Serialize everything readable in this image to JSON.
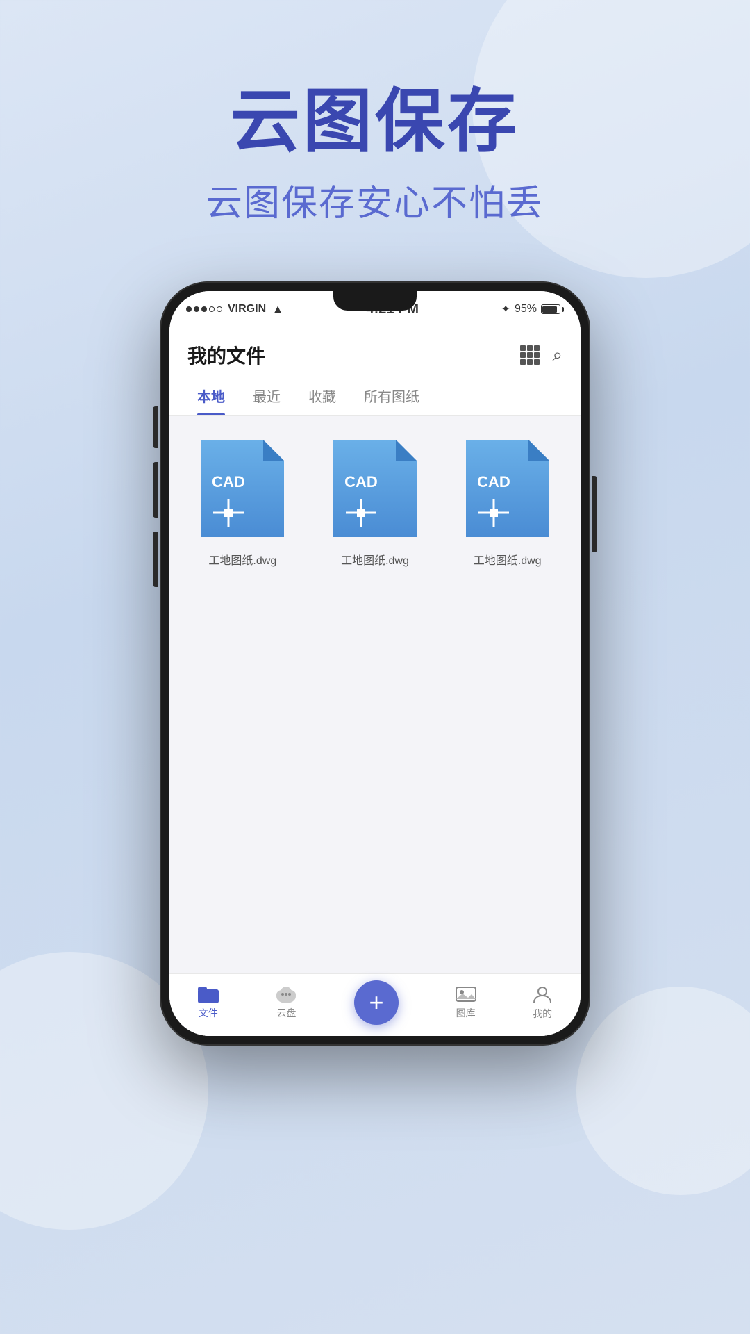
{
  "hero": {
    "title": "云图保存",
    "subtitle": "云图保存安心不怕丢"
  },
  "status_bar": {
    "carrier": "VIRGIN",
    "time": "4:21 PM",
    "battery": "95%"
  },
  "app": {
    "title": "我的文件",
    "tabs": [
      {
        "label": "本地",
        "active": true
      },
      {
        "label": "最近",
        "active": false
      },
      {
        "label": "收藏",
        "active": false
      },
      {
        "label": "所有图纸",
        "active": false
      }
    ],
    "files": [
      {
        "name": "工地图纸.dwg"
      },
      {
        "name": "工地图纸.dwg"
      },
      {
        "name": "工地图纸.dwg"
      }
    ]
  },
  "bottom_nav": {
    "items": [
      {
        "label": "文件",
        "active": true
      },
      {
        "label": "云盘",
        "active": false
      },
      {
        "label": "",
        "is_add": true
      },
      {
        "label": "图库",
        "active": false
      },
      {
        "label": "我的",
        "active": false
      }
    ]
  }
}
